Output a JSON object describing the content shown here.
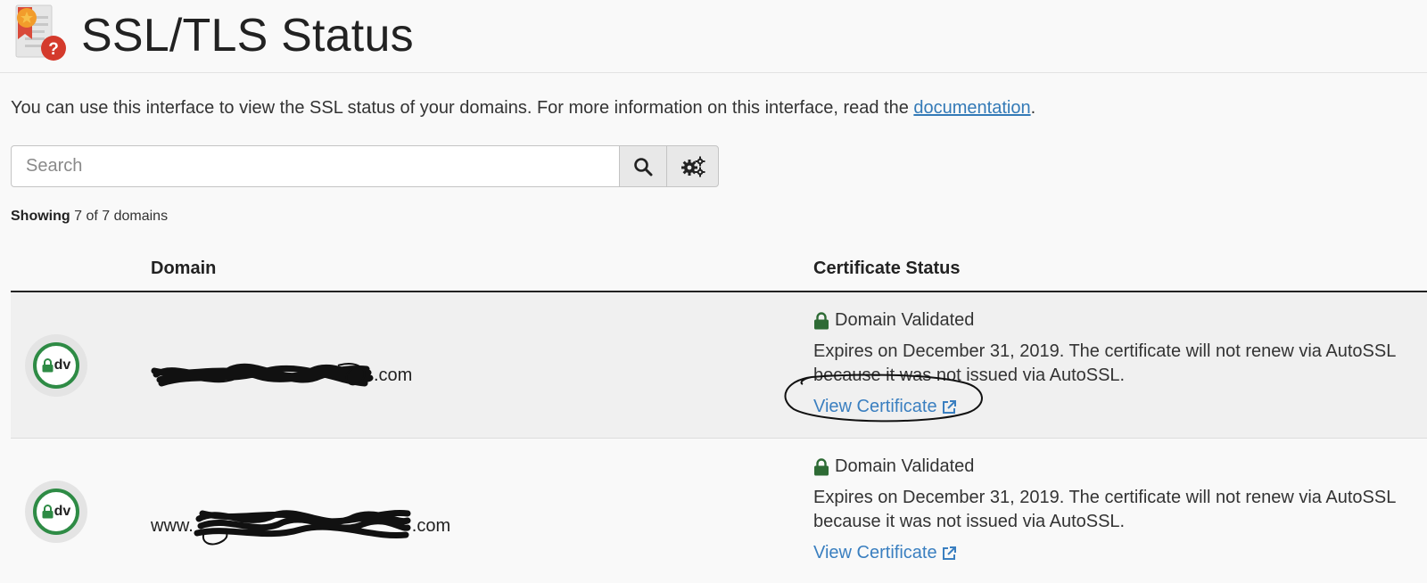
{
  "header": {
    "title": "SSL/TLS Status"
  },
  "intro": {
    "text": "You can use this interface to view the SSL status of your domains. For more information on this interface, read the ",
    "link_label": "documentation",
    "suffix": "."
  },
  "search": {
    "placeholder": "Search",
    "value": ""
  },
  "showing": {
    "label": "Showing",
    "count_text": "7 of 7 domains"
  },
  "table": {
    "columns": [
      "Domain",
      "Certificate Status"
    ],
    "rows": [
      {
        "badge": "dv",
        "domain_prefix": "",
        "domain_suffix": ".com",
        "status": "Domain Validated",
        "expires": "Expires on December 31, 2019. The certificate will not renew via AutoSSL because it was not issued via AutoSSL.",
        "view_label": "View Certificate"
      },
      {
        "badge": "dv",
        "domain_prefix": "www.",
        "domain_suffix": ".com",
        "status": "Domain Validated",
        "expires": "Expires on December 31, 2019. The certificate will not renew via AutoSSL because it was not issued via AutoSSL.",
        "view_label": "View Certificate"
      }
    ]
  },
  "colors": {
    "link": "#337ab7",
    "lock_green": "#2e6b35",
    "badge_ring": "#2e8b45",
    "error_red": "#d43a2c"
  }
}
